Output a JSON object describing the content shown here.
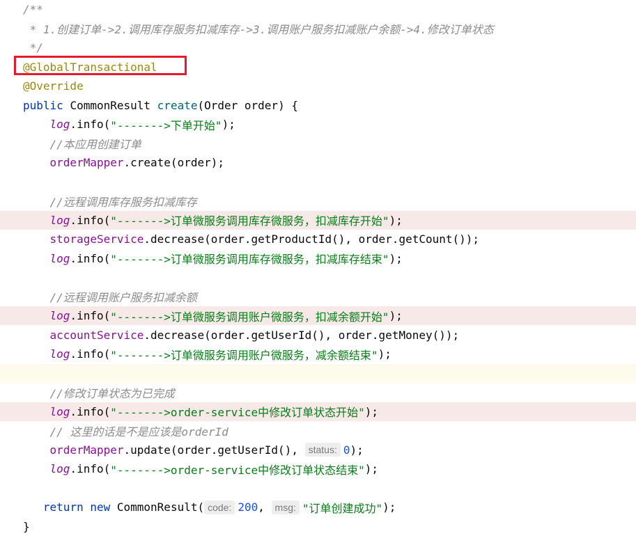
{
  "code": {
    "lines": [
      [
        {
          "t": "/**",
          "c": "comment"
        }
      ],
      [
        {
          "t": " * 1.创建订单->2.调用库存服务扣减库存->3.调用账户服务扣减账户余额->4.修改订单状态",
          "c": "comment"
        }
      ],
      [
        {
          "t": " */",
          "c": "comment"
        }
      ],
      [
        {
          "t": "@GlobalTransactional",
          "c": "annot"
        }
      ],
      [
        {
          "t": "@Override",
          "c": "annot"
        }
      ],
      [
        {
          "t": "public ",
          "c": "kw"
        },
        {
          "t": "CommonResult ",
          "c": ""
        },
        {
          "t": "create",
          "c": "fn"
        },
        {
          "t": "(Order order) {",
          "c": ""
        }
      ],
      [
        {
          "t": "    ",
          "c": ""
        },
        {
          "t": "log",
          "c": "logf"
        },
        {
          "t": ".info(",
          "c": ""
        },
        {
          "t": "\"------->下单开始\"",
          "c": "str"
        },
        {
          "t": ");",
          "c": ""
        }
      ],
      [
        {
          "t": "    //本应用创建订单",
          "c": "comment"
        }
      ],
      [
        {
          "t": "    ",
          "c": ""
        },
        {
          "t": "orderMapper",
          "c": "field"
        },
        {
          "t": ".create(order);",
          "c": ""
        }
      ],
      [],
      [
        {
          "t": "    //远程调用库存服务扣减库存",
          "c": "comment"
        }
      ],
      [
        {
          "t": "    ",
          "c": ""
        },
        {
          "t": "log",
          "c": "logf"
        },
        {
          "t": ".info(",
          "c": ""
        },
        {
          "t": "\"------->订单微服务调用库存微服务，扣减库存开始\"",
          "c": "str"
        },
        {
          "t": ");",
          "c": ""
        }
      ],
      [
        {
          "t": "    ",
          "c": ""
        },
        {
          "t": "storageService",
          "c": "field"
        },
        {
          "t": ".decrease(order.getProductId(), order.getCount());",
          "c": ""
        }
      ],
      [
        {
          "t": "    ",
          "c": ""
        },
        {
          "t": "log",
          "c": "logf"
        },
        {
          "t": ".info(",
          "c": ""
        },
        {
          "t": "\"------->订单微服务调用库存微服务，扣减库存结束\"",
          "c": "str"
        },
        {
          "t": ");",
          "c": ""
        }
      ],
      [],
      [
        {
          "t": "    //远程调用账户服务扣减余额",
          "c": "comment"
        }
      ],
      [
        {
          "t": "    ",
          "c": ""
        },
        {
          "t": "log",
          "c": "logf"
        },
        {
          "t": ".info(",
          "c": ""
        },
        {
          "t": "\"------->订单微服务调用账户微服务，扣减余额开始\"",
          "c": "str"
        },
        {
          "t": ");",
          "c": ""
        }
      ],
      [
        {
          "t": "    ",
          "c": ""
        },
        {
          "t": "accountService",
          "c": "field"
        },
        {
          "t": ".decrease(order.getUserId(), order.getMoney());",
          "c": ""
        }
      ],
      [
        {
          "t": "    ",
          "c": ""
        },
        {
          "t": "log",
          "c": "logf"
        },
        {
          "t": ".info(",
          "c": ""
        },
        {
          "t": "\"------->订单微服务调用账户微服务，减余额结束\"",
          "c": "str"
        },
        {
          "t": ");",
          "c": ""
        }
      ],
      [],
      [
        {
          "t": "    //修改订单状态为已完成",
          "c": "comment"
        }
      ],
      [
        {
          "t": "    ",
          "c": ""
        },
        {
          "t": "log",
          "c": "logf"
        },
        {
          "t": ".info(",
          "c": ""
        },
        {
          "t": "\"------->order-service中修改订单状态开始\"",
          "c": "str"
        },
        {
          "t": ");",
          "c": ""
        }
      ],
      [
        {
          "t": "    // 这里的话是不是应该是orderId",
          "c": "comment"
        }
      ],
      [
        {
          "t": "    ",
          "c": ""
        },
        {
          "t": "orderMapper",
          "c": "field"
        },
        {
          "t": ".update(order.getUserId(), ",
          "c": ""
        },
        {
          "t": "status:",
          "c": "hint"
        },
        {
          "t": "0",
          "c": "num"
        },
        {
          "t": ");",
          "c": ""
        }
      ],
      [
        {
          "t": "    ",
          "c": ""
        },
        {
          "t": "log",
          "c": "logf"
        },
        {
          "t": ".info(",
          "c": ""
        },
        {
          "t": "\"------->order-service中修改订单状态结束\"",
          "c": "str"
        },
        {
          "t": ");",
          "c": ""
        }
      ],
      [],
      [
        {
          "t": "   ",
          "c": ""
        },
        {
          "t": "return ",
          "c": "kw"
        },
        {
          "t": "new ",
          "c": "kw"
        },
        {
          "t": "CommonResult(",
          "c": ""
        },
        {
          "t": "code:",
          "c": "hint"
        },
        {
          "t": "200",
          "c": "num"
        },
        {
          "t": ", ",
          "c": ""
        },
        {
          "t": "msg:",
          "c": "hint"
        },
        {
          "t": "\"订单创建成功\"",
          "c": "str"
        },
        {
          "t": ");",
          "c": ""
        }
      ],
      [
        {
          "t": "}",
          "c": ""
        }
      ]
    ],
    "highlighted_lines": [
      11,
      16,
      21
    ],
    "caret_line": 19,
    "boxed_line": 3
  },
  "colors": {
    "comment": "#8c8c8c",
    "annotation": "#9e880d",
    "keyword": "#0033b3",
    "method": "#00627a",
    "field": "#871094",
    "string": "#067d17",
    "number": "#1750eb",
    "line_highlight": "#f6e9e7",
    "annotation_box": "#e8192c"
  }
}
